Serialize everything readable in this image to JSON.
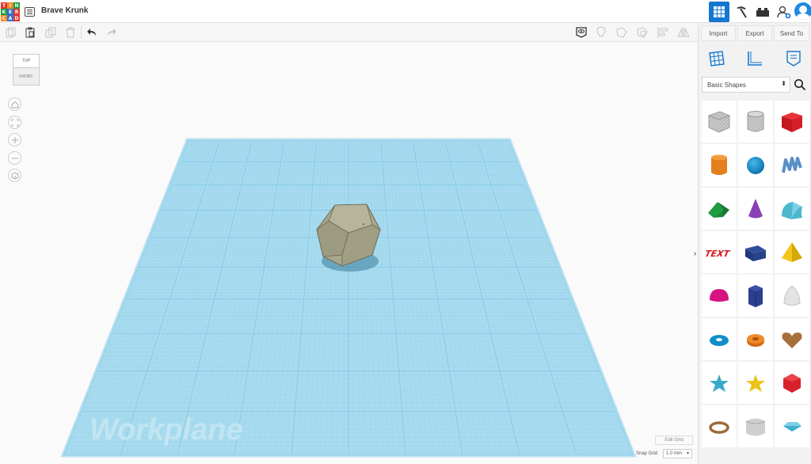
{
  "header": {
    "doc_title": "Brave Krunk",
    "logo_letters": [
      "T",
      "I",
      "N",
      "K",
      "E",
      "R",
      "C",
      "A",
      "D"
    ],
    "logo_colors": [
      "#e2352b",
      "#f08b21",
      "#1a9c3c",
      "#1a9c3c",
      "#2f6fce",
      "#e2352b",
      "#f08b21",
      "#2f6fce",
      "#e2352b"
    ]
  },
  "panel": {
    "import_label": "Import",
    "export_label": "Export",
    "send_to_label": "Send To",
    "shape_category": "Basic Shapes"
  },
  "workspace": {
    "viewcube_top": "TOP",
    "viewcube_front": "FRONT",
    "workplane_label": "Workplane",
    "edit_grid_label": "Edit Grid",
    "snap_grid_label": "Snap Grid",
    "snap_grid_value": "1.0 mm"
  },
  "shapes": [
    "box-hole",
    "cylinder-hole",
    "box",
    "cylinder",
    "sphere",
    "scribble",
    "roof",
    "cone",
    "round-roof",
    "text",
    "wedge",
    "pyramid",
    "half-sphere",
    "polygon",
    "paraboloid",
    "torus",
    "tube",
    "heart",
    "star",
    "star-gold",
    "icosahedron",
    "ring",
    "wedge-round",
    "diamond"
  ],
  "colors": {
    "accent": "#1477d1",
    "workplane": "#a9dbef",
    "grid_line": "#7ec8e6",
    "object": "#a8a68a"
  }
}
